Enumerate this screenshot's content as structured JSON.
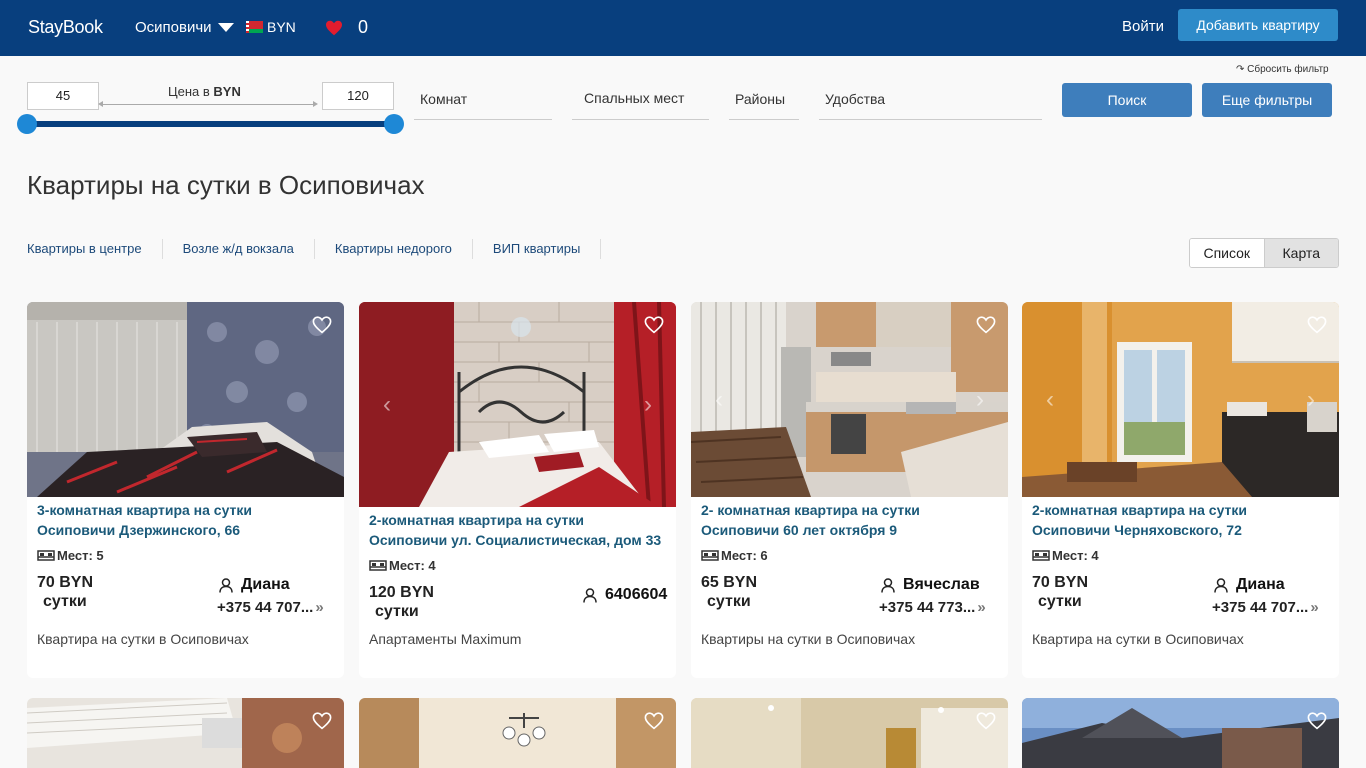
{
  "header": {
    "logo": "StayBook",
    "city": "Осиповичи",
    "currency": "BYN",
    "favorites_count": "0",
    "login": "Войти",
    "add_apartment": "Добавить квартиру"
  },
  "filters": {
    "price_min": "45",
    "price_max": "120",
    "price_label": "Цена в",
    "price_currency": "BYN",
    "price_range": [
      45,
      120
    ],
    "rooms": "Комнат",
    "sleeping_places": "Спальных мест",
    "districts": "Районы",
    "amenities": "Удобства",
    "reset": "↷ Сбросить фильтр",
    "search": "Поиск",
    "more_filters": "Еще фильтры"
  },
  "page": {
    "title": "Квартиры на сутки в Осиповичах",
    "quick_links": [
      "Квартиры в центре",
      "Возле ж/д вокзала",
      "Квартиры недорого",
      "ВИП квартиры"
    ],
    "view_list": "Список",
    "view_map": "Карта"
  },
  "cards": [
    {
      "title_line1": "3-комнатная квартира на сутки",
      "title_line2": "Осиповичи Дзержинского, 66",
      "places": "Мест: 5",
      "price": "70 BYN",
      "per": "сутки",
      "owner": "Диана",
      "phone": "+375 44 707...",
      "description": "Квартира на сутки в Осиповичах"
    },
    {
      "title_line1": "2-комнатная квартира на сутки",
      "title_line2": "Осиповичи ул. Социалистическая, дом 33",
      "places": "Мест: 4",
      "price": "120 BYN",
      "per": "сутки",
      "owner": "6406604",
      "phone": "",
      "description": "Апартаменты Maximum"
    },
    {
      "title_line1": "2- комнатная квартира на сутки",
      "title_line2": "Осиповичи 60 лет октября 9",
      "places": "Мест: 6",
      "price": "65 BYN",
      "per": "сутки",
      "owner": "Вячеслав",
      "phone": "+375 44 773...",
      "description": "Квартиры на сутки в Осиповичах"
    },
    {
      "title_line1": "2-комнатная квартира на сутки",
      "title_line2": "Осиповичи Черняховского, 72",
      "places": "Мест: 4",
      "price": "70 BYN",
      "per": "сутки",
      "owner": "Диана",
      "phone": "+375 44 707...",
      "description": "Квартира на сутки в Осиповичах"
    }
  ],
  "colors": {
    "header_bg": "#083f7e",
    "accent": "#3e7ebc",
    "title_link": "#1b5a7a"
  }
}
